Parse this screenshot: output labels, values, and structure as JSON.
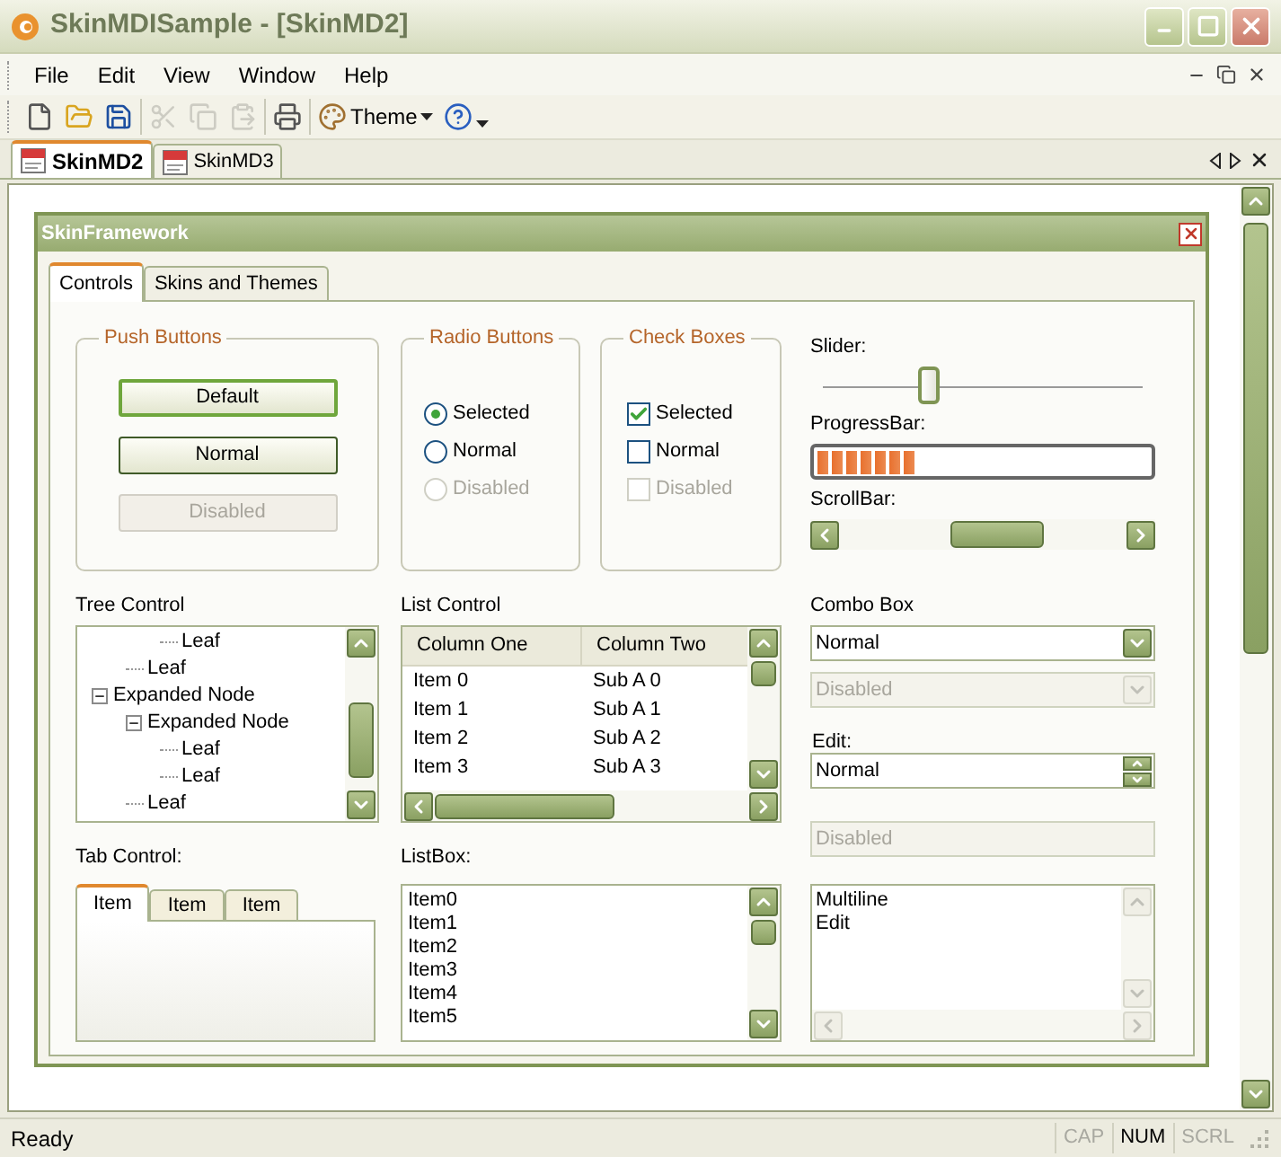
{
  "window": {
    "title": "SkinMDISample - [SkinMD2]"
  },
  "menu": [
    "File",
    "Edit",
    "View",
    "Window",
    "Help"
  ],
  "toolbar": {
    "groups": [
      [
        {
          "kind": "new",
          "disabled": false
        },
        {
          "kind": "open",
          "disabled": false
        },
        {
          "kind": "save",
          "disabled": false
        }
      ],
      [
        {
          "kind": "cut",
          "disabled": true
        },
        {
          "kind": "copy",
          "disabled": true
        },
        {
          "kind": "paste",
          "disabled": true
        }
      ],
      [
        {
          "kind": "print",
          "disabled": false
        }
      ],
      [
        {
          "kind": "theme",
          "label": "Theme",
          "disabled": false
        },
        {
          "kind": "help",
          "disabled": false
        }
      ]
    ]
  },
  "document_tabs": [
    {
      "label": "SkinMD2",
      "selected": true
    },
    {
      "label": "SkinMD3",
      "selected": false
    }
  ],
  "dialog": {
    "title": "SkinFramework",
    "tabs": [
      {
        "label": "Controls",
        "selected": true
      },
      {
        "label": "Skins and Themes",
        "selected": false
      }
    ],
    "push_buttons": {
      "title": "Push Buttons",
      "buttons": [
        {
          "label": "Default",
          "kind": "default",
          "disabled": false
        },
        {
          "label": "Normal",
          "kind": "normal",
          "disabled": false
        },
        {
          "label": "Disabled",
          "kind": "normal",
          "disabled": true
        }
      ]
    },
    "radio_buttons": {
      "title": "Radio Buttons",
      "items": [
        {
          "label": "Selected",
          "selected": true,
          "disabled": false
        },
        {
          "label": "Normal",
          "selected": false,
          "disabled": false
        },
        {
          "label": "Disabled",
          "selected": false,
          "disabled": true
        }
      ]
    },
    "check_boxes": {
      "title": "Check Boxes",
      "items": [
        {
          "label": "Selected",
          "checked": true,
          "disabled": false
        },
        {
          "label": "Normal",
          "checked": false,
          "disabled": false
        },
        {
          "label": "Disabled",
          "checked": false,
          "disabled": true
        }
      ]
    },
    "slider": {
      "label": "Slider:",
      "level": 0.33
    },
    "progress_bar": {
      "label": "ProgressBar:",
      "level": 0.3
    },
    "scroll_bar": {
      "label": "ScrollBar:"
    },
    "tree_control": {
      "label": "Tree Control",
      "items": [
        {
          "children": [
            {
              "children": [
                {
                  "label": "Leaf"
                }
              ]
            },
            {
              "label": "Leaf"
            }
          ]
        },
        {
          "label": "Expanded Node",
          "expanded": true,
          "children": [
            {
              "label": "Expanded Node",
              "expanded": true,
              "children": [
                {
                  "label": "Leaf"
                },
                {
                  "label": "Leaf"
                }
              ]
            },
            {
              "label": "Leaf"
            }
          ]
        }
      ]
    },
    "list_control": {
      "label": "List Control",
      "columns": [
        "Column One",
        "Column Two"
      ],
      "rows": [
        [
          "Item 0",
          "Sub A 0"
        ],
        [
          "Item 1",
          "Sub A 1"
        ],
        [
          "Item 2",
          "Sub A 2"
        ],
        [
          "Item 3",
          "Sub A 3"
        ]
      ]
    },
    "combo_box": {
      "label": "Combo Box",
      "boxes": [
        {
          "value": "Normal",
          "disabled": false
        },
        {
          "value": "Disabled",
          "disabled": true
        }
      ]
    },
    "edit": {
      "label": "Edit:",
      "fields": [
        {
          "kind": "spin",
          "value": "Normal",
          "disabled": false
        },
        {
          "kind": "plain",
          "value": "Disabled",
          "disabled": true
        }
      ],
      "multiline": "Multiline\nEdit"
    },
    "tab_control": {
      "label": "Tab Control:",
      "tabs": [
        {
          "label": "Item",
          "selected": true
        },
        {
          "label": "Item",
          "selected": false
        },
        {
          "label": "Item",
          "selected": false
        }
      ]
    },
    "list_box": {
      "label": "ListBox:",
      "items": [
        "Item0",
        "Item1",
        "Item2",
        "Item3",
        "Item4",
        "Item5"
      ]
    }
  },
  "status_bar": {
    "text": "Ready",
    "indicators": [
      {
        "label": "CAP",
        "on": false
      },
      {
        "label": "NUM",
        "on": true
      },
      {
        "label": "SCRL",
        "on": false
      }
    ]
  }
}
